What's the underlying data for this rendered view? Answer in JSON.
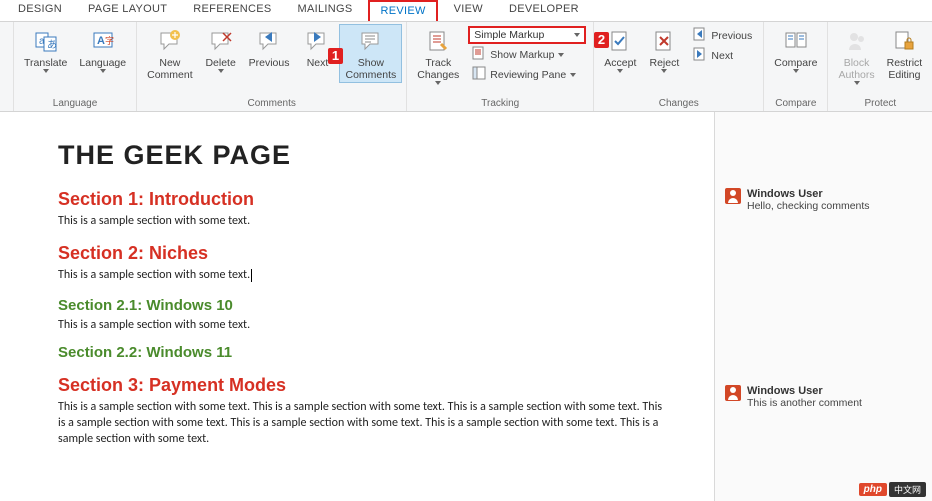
{
  "tabs": {
    "design": "DESIGN",
    "page_layout": "PAGE LAYOUT",
    "references": "REFERENCES",
    "mailings": "MAILINGS",
    "review": "REVIEW",
    "view": "VIEW",
    "developer": "DEVELOPER"
  },
  "callouts": {
    "one": "1",
    "two": "2"
  },
  "ribbon": {
    "language": {
      "translate": "Translate",
      "language_btn": "Language",
      "group": "Language"
    },
    "comments": {
      "new": "New\nComment",
      "delete": "Delete",
      "previous": "Previous",
      "next": "Next",
      "show": "Show\nComments",
      "group": "Comments"
    },
    "tracking": {
      "track_changes": "Track\nChanges",
      "markup_dd": "Simple Markup",
      "show_markup": "Show Markup",
      "reviewing_pane": "Reviewing Pane",
      "group": "Tracking"
    },
    "changes": {
      "accept": "Accept",
      "reject": "Reject",
      "previous": "Previous",
      "next": "Next",
      "group": "Changes"
    },
    "compare": {
      "compare": "Compare",
      "group": "Compare"
    },
    "protect": {
      "block_authors": "Block\nAuthors",
      "restrict": "Restrict\nEditing",
      "group": "Protect"
    }
  },
  "document": {
    "title": "THE GEEK PAGE",
    "s1": {
      "h": "Section 1: Introduction",
      "t": "This is a sample section with some text."
    },
    "s2": {
      "h": "Section 2: Niches",
      "t": "This is a sample section with some text."
    },
    "s21": {
      "h": "Section 2.1: Windows 10",
      "t": "This is a sample section with some text."
    },
    "s22": {
      "h": "Section 2.2: Windows 11"
    },
    "s3": {
      "h": "Section 3: Payment Modes",
      "t": "This is a sample section with some text. This is a sample section with some text. This is a sample section with some text. This is a sample section with some text. This is a sample section with some text. This is a sample section with some text. This is a sample section with some text."
    }
  },
  "comments_pane": {
    "c1": {
      "user": "Windows User",
      "text": "Hello, checking comments"
    },
    "c2": {
      "user": "Windows User",
      "text": "This is another comment"
    }
  },
  "watermark": {
    "php": "php",
    "cn": "中文网"
  }
}
